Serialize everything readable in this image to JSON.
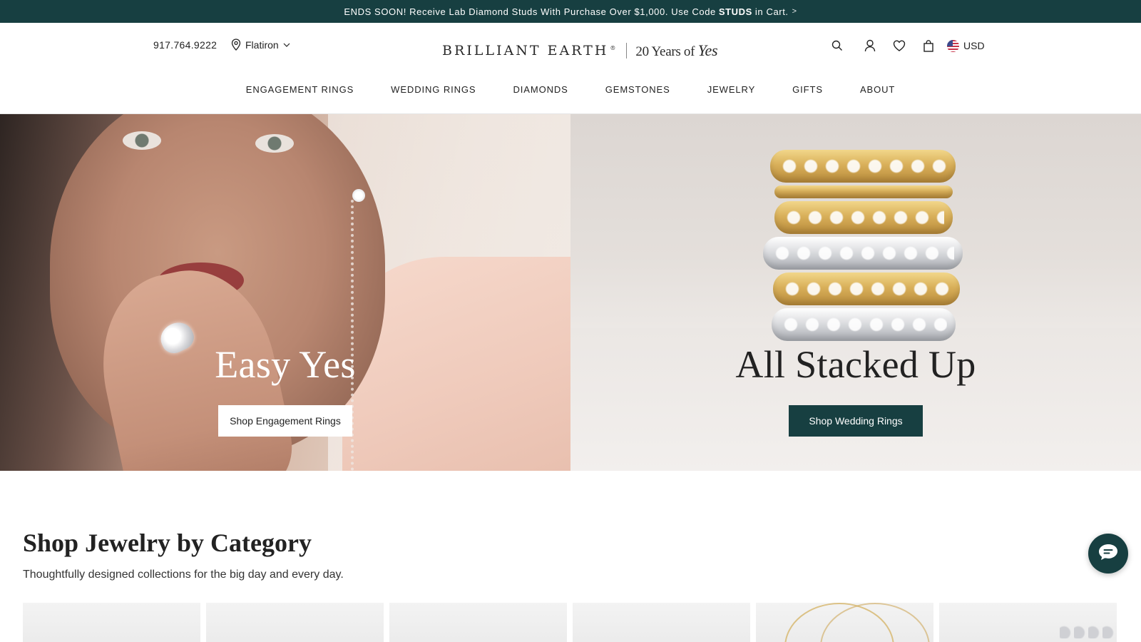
{
  "promo": {
    "text_before": "ENDS SOON! Receive Lab Diamond Studs With Purchase Over $1,000. Use Code",
    "code": "STUDS",
    "text_after": "in Cart.",
    "chevron": ">"
  },
  "header": {
    "phone": "917.764.9222",
    "store": "Flatiron",
    "logo_brand": "BRILLIANT EARTH",
    "logo_reg": "®",
    "logo_anniversary": "20 Years of",
    "logo_yes": "Yes",
    "currency": "USD"
  },
  "nav": {
    "items": [
      "ENGAGEMENT RINGS",
      "WEDDING RINGS",
      "DIAMONDS",
      "GEMSTONES",
      "JEWELRY",
      "GIFTS",
      "ABOUT"
    ]
  },
  "hero": {
    "left": {
      "title": "Easy Yes",
      "button": "Shop Engagement Rings"
    },
    "right": {
      "title": "All Stacked Up",
      "button": "Shop Wedding Rings"
    }
  },
  "category": {
    "title": "Shop Jewelry by Category",
    "subtitle": "Thoughtfully designed collections for the big day and every day."
  },
  "colors": {
    "brand_green": "#173f41",
    "white": "#ffffff"
  },
  "icons": [
    "location-pin-icon",
    "chevron-down-icon",
    "search-icon",
    "user-icon",
    "heart-icon",
    "bag-icon",
    "us-flag-icon",
    "chat-icon"
  ]
}
